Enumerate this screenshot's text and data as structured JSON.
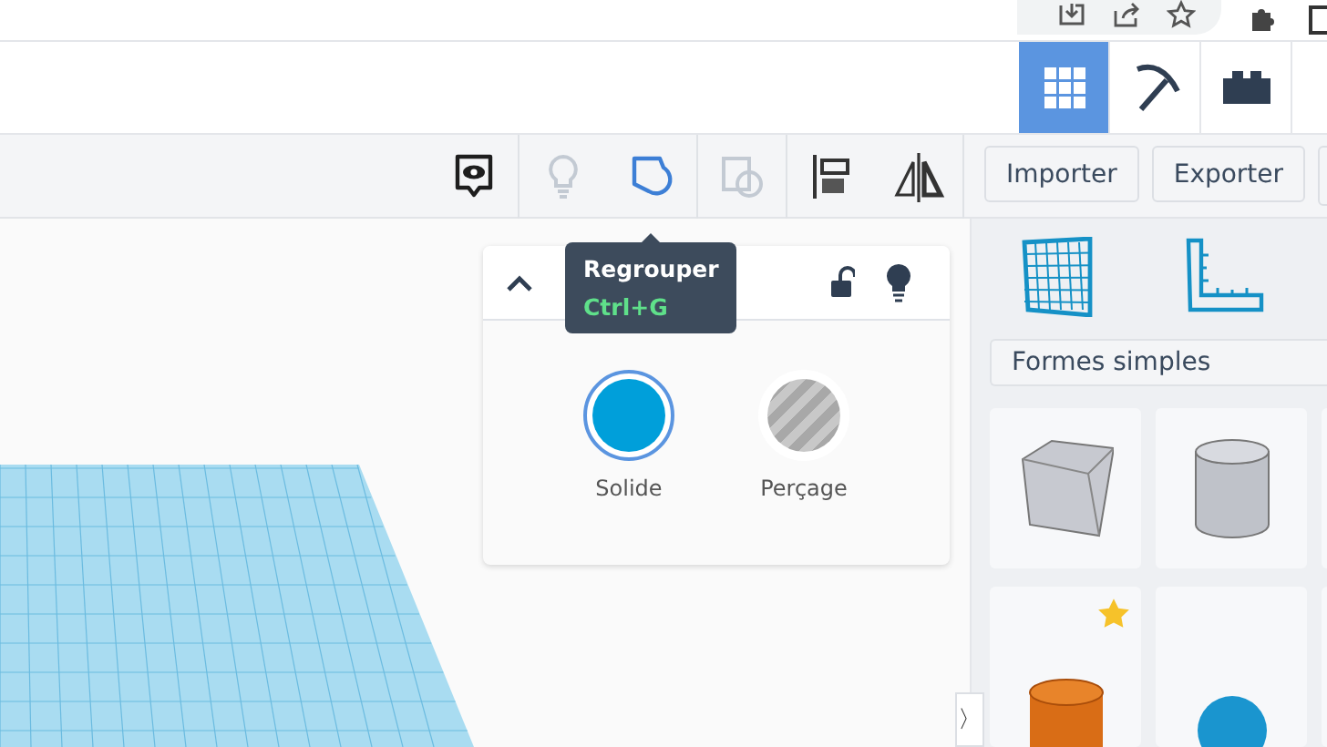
{
  "view_modes": [
    {
      "kind": "grid",
      "selected": true
    },
    {
      "kind": "pickaxe",
      "selected": false
    },
    {
      "kind": "brick",
      "selected": false
    }
  ],
  "toolbar": {
    "tools": [
      {
        "kind": "notes",
        "disabled": false
      },
      {
        "kind": "bulb",
        "disabled": true
      },
      {
        "kind": "group",
        "disabled": false
      },
      {
        "kind": "ungroup",
        "disabled": true
      },
      {
        "kind": "align",
        "disabled": false
      },
      {
        "kind": "mirror",
        "disabled": false
      }
    ],
    "buttons": [
      "Importer",
      "Exporter"
    ]
  },
  "tooltip": {
    "title": "Regrouper",
    "shortcut": "Ctrl+G"
  },
  "shape_panel": {
    "expanded": true,
    "locked": false,
    "options": [
      {
        "kind": "solid",
        "label": "Solide",
        "selected": true
      },
      {
        "kind": "hole",
        "label": "Perçage",
        "selected": false
      }
    ]
  },
  "sidebar": {
    "category": "Formes simples",
    "shapes": [
      {
        "kind": "box",
        "favorite": false
      },
      {
        "kind": "cylinder",
        "favorite": false
      },
      {
        "kind": "cylinder-orange",
        "favorite": true
      },
      {
        "kind": "sphere",
        "favorite": false
      }
    ]
  },
  "collapse_handle": "〉"
}
